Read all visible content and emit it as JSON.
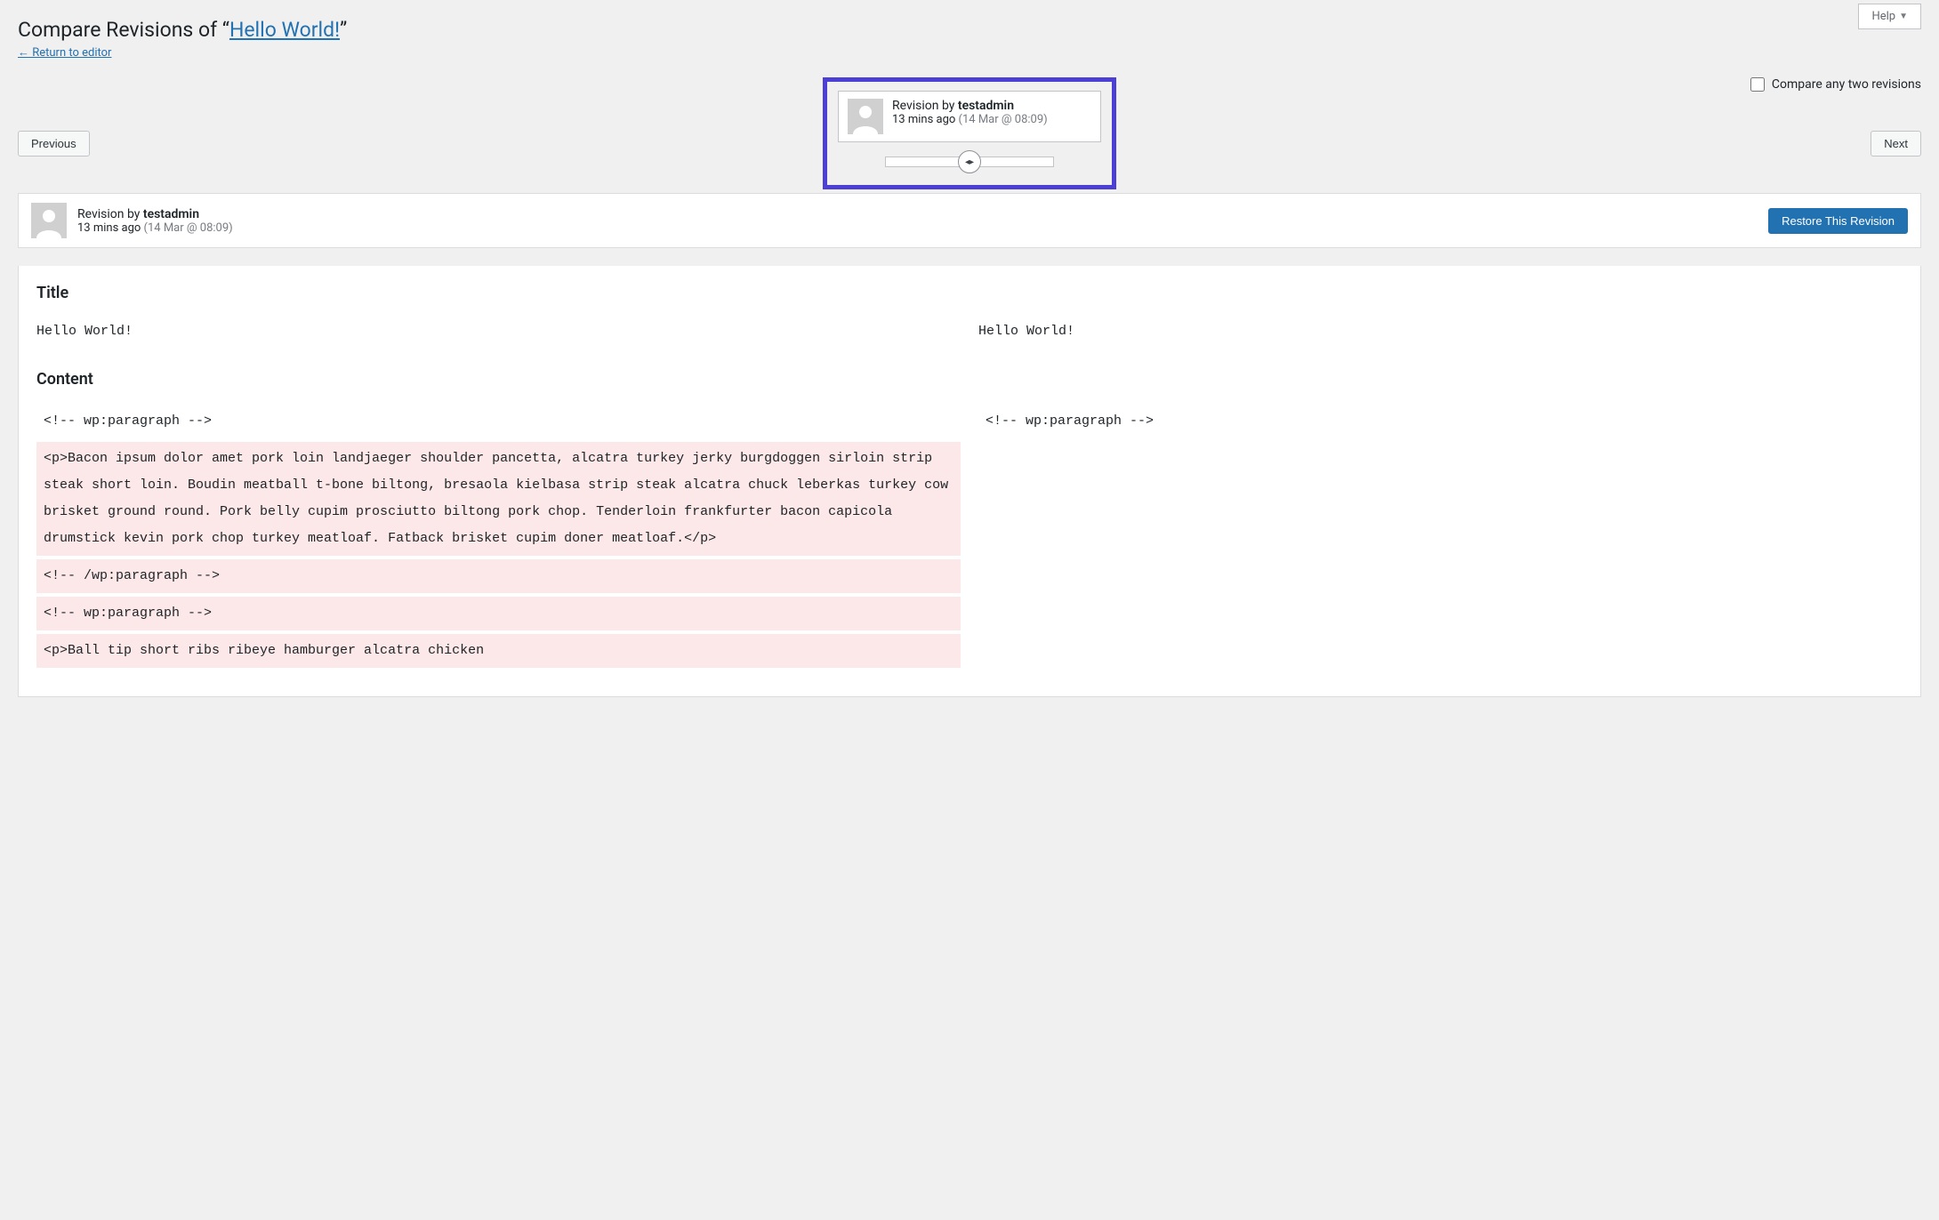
{
  "help": {
    "label": "Help"
  },
  "page": {
    "title_prefix": "Compare Revisions of “",
    "title_link": "Hello World!",
    "title_suffix": "”",
    "return_link": "← Return to editor"
  },
  "compare_toggle": {
    "label": "Compare any two revisions"
  },
  "nav": {
    "previous": "Previous",
    "next": "Next"
  },
  "tooltip": {
    "by_prefix": "Revision by ",
    "author": "testadmin",
    "ago": "13 mins ago ",
    "date": "(14 Mar @ 08:09)"
  },
  "meta": {
    "by_prefix": "Revision by ",
    "author": "testadmin",
    "ago": "13 mins ago ",
    "date": "(14 Mar @ 08:09)",
    "restore_button": "Restore This Revision"
  },
  "diff": {
    "title_heading": "Title",
    "content_heading": "Content",
    "title_left": "Hello World!",
    "title_right": "Hello World!",
    "content_left": [
      {
        "text": "<!-- wp:paragraph -->",
        "removed": false
      },
      {
        "text": "<p>Bacon ipsum dolor amet pork loin landjaeger shoulder pancetta, alcatra turkey jerky burgdoggen sirloin strip steak short loin. Boudin meatball t-bone biltong, bresaola kielbasa strip steak alcatra chuck leberkas turkey cow brisket ground round. Pork belly cupim prosciutto biltong pork chop. Tenderloin frankfurter bacon capicola drumstick kevin pork chop turkey meatloaf. Fatback brisket cupim doner meatloaf.</p>",
        "removed": true
      },
      {
        "text": "<!-- /wp:paragraph -->",
        "removed": true
      },
      {
        "text": "<!-- wp:paragraph -->",
        "removed": true
      },
      {
        "text": "<p>Ball tip short ribs ribeye hamburger alcatra chicken",
        "removed": true
      }
    ],
    "content_right": [
      {
        "text": "<!-- wp:paragraph -->",
        "removed": false
      }
    ]
  }
}
